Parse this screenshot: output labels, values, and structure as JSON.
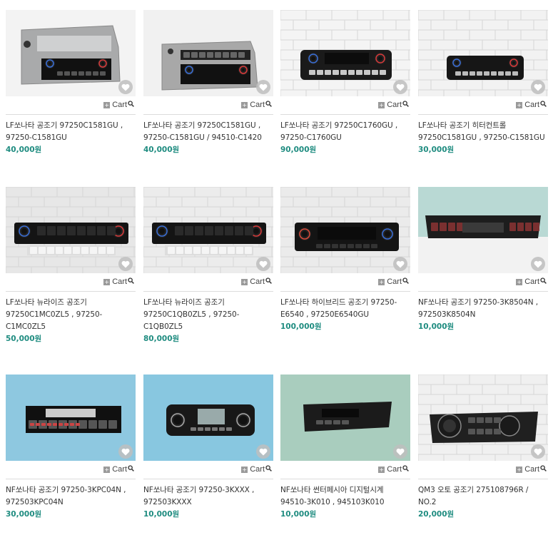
{
  "cart_label": "Cart",
  "icons": {
    "add": "plus-icon",
    "search": "magnifier-icon",
    "wish": "heart-icon"
  },
  "colors": {
    "price": "#1f8c80",
    "divider": "#dcdcdc",
    "heart_bg": "#bebebe"
  },
  "products": [
    {
      "title_line1": "LF쏘나타 공조기 97250C1581GU ,",
      "title_line2": "97250-C1581GU",
      "title_line3": "",
      "price": "40,000원"
    },
    {
      "title_line1": "LF쏘나타 공조기 97250C1581GU ,",
      "title_line2": "97250-C1581GU / 94510-C1420",
      "title_line3": "",
      "price": "40,000원"
    },
    {
      "title_line1": "LF쏘나타 공조기 97250C1760GU ,",
      "title_line2": "97250-C1760GU",
      "title_line3": "",
      "price": "90,000원"
    },
    {
      "title_line1": "LF쏘나타 공조기 히터컨트롤",
      "title_line2": "97250C1581GU , 97250-C1581GU",
      "title_line3": "",
      "price": "30,000원"
    },
    {
      "title_line1": "LF쏘나타 뉴라이즈 공조기",
      "title_line2": "97250C1MC0ZL5 , 97250-",
      "title_line3": "C1MC0ZL5",
      "price": "50,000원"
    },
    {
      "title_line1": "LF쏘나타 뉴라이즈 공조기",
      "title_line2": "97250C1QB0ZL5 , 97250-",
      "title_line3": "C1QB0ZL5",
      "price": "80,000원"
    },
    {
      "title_line1": "LF쏘나타 하이브리드 공조기 97250-",
      "title_line2": "E6540 , 97250E6540GU",
      "title_line3": "",
      "price": "100,000원"
    },
    {
      "title_line1": "NF쏘나타 공조기 97250-3K8504N ,",
      "title_line2": "972503K8504N",
      "title_line3": "",
      "price": "10,000원"
    },
    {
      "title_line1": "NF쏘나타 공조기 97250-3KPC04N ,",
      "title_line2": "972503KPC04N",
      "title_line3": "",
      "price": "30,000원"
    },
    {
      "title_line1": "NF쏘나타 공조기 97250-3KXXX ,",
      "title_line2": "972503KXXX",
      "title_line3": "",
      "price": "10,000원"
    },
    {
      "title_line1": "NF쏘나타 썬터페시아 디지털시계",
      "title_line2": "94510-3K010 , 945103K010",
      "title_line3": "",
      "price": "10,000원"
    },
    {
      "title_line1": "QM3 오토 공조기 275108796R /",
      "title_line2": "NO.2",
      "title_line3": "",
      "price": "20,000원"
    }
  ]
}
